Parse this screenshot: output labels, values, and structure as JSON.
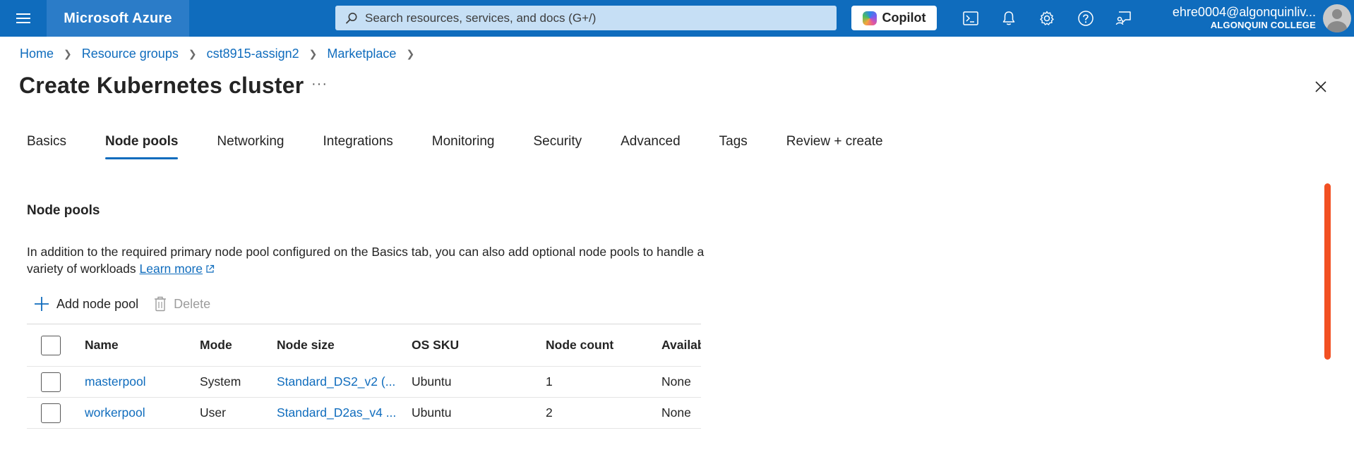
{
  "topbar": {
    "brand": "Microsoft Azure",
    "search_placeholder": "Search resources, services, and docs (G+/)",
    "copilot_label": "Copilot",
    "user_email": "ehre0004@algonquinliv...",
    "user_org": "ALGONQUIN COLLEGE",
    "icons": [
      "cloud-shell-icon",
      "notifications-icon",
      "settings-icon",
      "help-icon",
      "feedback-icon"
    ]
  },
  "breadcrumb": [
    "Home",
    "Resource groups",
    "cst8915-assign2",
    "Marketplace"
  ],
  "page": {
    "title": "Create Kubernetes cluster",
    "more": "···"
  },
  "tabs": [
    "Basics",
    "Node pools",
    "Networking",
    "Integrations",
    "Monitoring",
    "Security",
    "Advanced",
    "Tags",
    "Review + create"
  ],
  "active_tab": "Node pools",
  "section": {
    "title": "Node pools",
    "description": "In addition to the required primary node pool configured on the Basics tab, you can also add optional node pools to handle a variety of workloads",
    "learn_more": "Learn more"
  },
  "toolbar": {
    "add_label": "Add node pool",
    "delete_label": "Delete"
  },
  "table": {
    "columns": [
      "Name",
      "Mode",
      "Node size",
      "OS SKU",
      "Node count",
      "Availab"
    ],
    "rows": [
      {
        "name": "masterpool",
        "mode": "System",
        "size": "Standard_DS2_v2 (...",
        "os": "Ubuntu",
        "count": "1",
        "avail": "None"
      },
      {
        "name": "workerpool",
        "mode": "User",
        "size": "Standard_D2as_v4 ...",
        "os": "Ubuntu",
        "count": "2",
        "avail": "None"
      }
    ]
  },
  "colors": {
    "header_bg": "#0f6cbd",
    "brand_bg": "#2b7cc8",
    "link": "#0f6cbd",
    "scrollbar": "#f25022"
  }
}
